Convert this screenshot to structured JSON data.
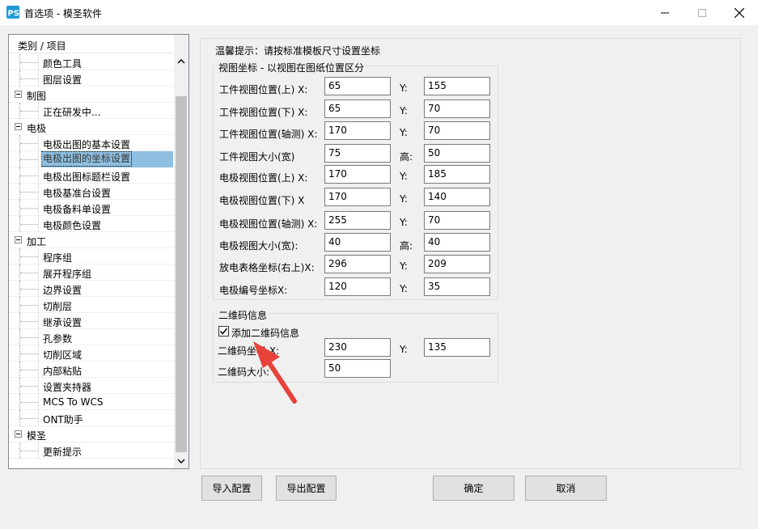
{
  "window": {
    "title": "首选项 - 模圣软件",
    "app_icon": "ps-logo-icon",
    "controls": [
      "minimize-icon",
      "maximize-icon",
      "close-icon"
    ]
  },
  "tree": {
    "header": "类别 / 项目",
    "rows": [
      {
        "label": "颜色工具",
        "level": 1
      },
      {
        "label": "图层设置",
        "level": 1
      },
      {
        "label": "制图",
        "level": 0
      },
      {
        "label": "正在研发中...",
        "level": 1
      },
      {
        "label": "电极",
        "level": 0
      },
      {
        "label": "电极出图的基本设置",
        "level": 1
      },
      {
        "label": "电极出图的坐标设置",
        "level": 1,
        "selected": true
      },
      {
        "label": "电极出图标题栏设置",
        "level": 1
      },
      {
        "label": "电极基准台设置",
        "level": 1
      },
      {
        "label": "电极备料单设置",
        "level": 1
      },
      {
        "label": "电极颜色设置",
        "level": 1
      },
      {
        "label": "加工",
        "level": 0
      },
      {
        "label": "程序组",
        "level": 1
      },
      {
        "label": "展开程序组",
        "level": 1
      },
      {
        "label": "边界设置",
        "level": 1
      },
      {
        "label": "切削层",
        "level": 1
      },
      {
        "label": "继承设置",
        "level": 1
      },
      {
        "label": "孔参数",
        "level": 1
      },
      {
        "label": "切削区域",
        "level": 1
      },
      {
        "label": "内部粘贴",
        "level": 1
      },
      {
        "label": "设置夹持器",
        "level": 1
      },
      {
        "label": "MCS To WCS",
        "level": 1
      },
      {
        "label": "ONT助手",
        "level": 1
      },
      {
        "label": "模圣",
        "level": 0
      },
      {
        "label": "更新提示",
        "level": 1
      }
    ]
  },
  "hint": "温馨提示：请按标准模板尺寸设置坐标",
  "view_group": {
    "legend": "视图坐标 - 以视图在图纸位置区分",
    "rows": [
      {
        "label": "工件视图位置(上) X:",
        "x": "65",
        "ylabel": "Y:",
        "y": "155"
      },
      {
        "label": "工件视图位置(下) X:",
        "x": "65",
        "ylabel": "Y:",
        "y": "70"
      },
      {
        "label": "工件视图位置(轴测) X:",
        "x": "170",
        "ylabel": "Y:",
        "y": "70"
      },
      {
        "label": "工件视图大小(宽)",
        "x": "75",
        "ylabel": "高:",
        "y": "50"
      },
      {
        "label": "电极视图位置(上) X:",
        "x": "170",
        "ylabel": "Y:",
        "y": "185"
      },
      {
        "label": "电极视图位置(下) X",
        "x": "170",
        "ylabel": "Y:",
        "y": "140"
      },
      {
        "label": "电极视图位置(轴测) X:",
        "x": "255",
        "ylabel": "Y:",
        "y": "70"
      },
      {
        "label": "电极视图大小(宽):",
        "x": "40",
        "ylabel": "高:",
        "y": "40"
      },
      {
        "label": "放电表格坐标(右上)X:",
        "x": "296",
        "ylabel": "Y:",
        "y": "209"
      },
      {
        "label": "电极编号坐标X:",
        "x": "120",
        "ylabel": "Y:",
        "y": "35"
      }
    ]
  },
  "qr_group": {
    "legend": "二维码信息",
    "checkbox_label": "添加二维码信息",
    "checkbox_checked": true,
    "coord_label": "二维码坐标 X:",
    "coord_x": "230",
    "coord_ylabel": "Y:",
    "coord_y": "135",
    "size_label": "二维码大小:",
    "size": "50"
  },
  "buttons": {
    "import": "导入配置",
    "export": "导出配置",
    "ok": "确定",
    "cancel": "取消"
  },
  "colors": {
    "selection": "#8fbfe0",
    "arrow": "#e8413a",
    "icon_blue": "#1f9ad6"
  }
}
